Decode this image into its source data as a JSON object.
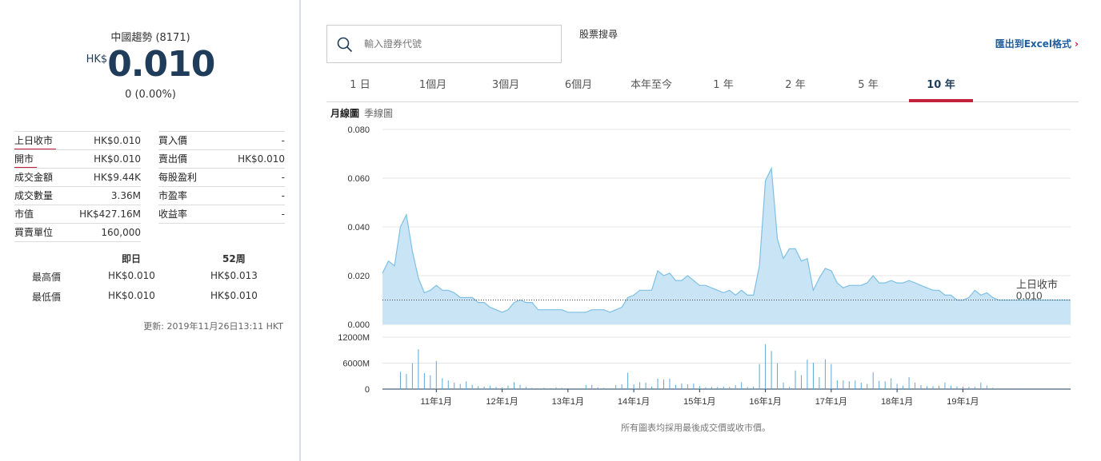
{
  "quote": {
    "name": "中國趨勢 (8171)",
    "currency": "HK$",
    "price": "0.010",
    "change": "0 (0.00%)"
  },
  "stats_left": [
    {
      "label": "上日收市",
      "value": "HK$0.010"
    },
    {
      "label": "開市",
      "value": "HK$0.010"
    },
    {
      "label": "成交金額",
      "value": "HK$9.44K"
    },
    {
      "label": "成交數量",
      "value": "3.36M"
    },
    {
      "label": "市值",
      "value": "HK$427.16M"
    },
    {
      "label": "買賣單位",
      "value": "160,000"
    }
  ],
  "stats_right": [
    {
      "label": "買入價",
      "value": "-"
    },
    {
      "label": "賣出價",
      "value": "HK$0.010"
    },
    {
      "label": "每股盈利",
      "value": "-"
    },
    {
      "label": "市盈率",
      "value": "-"
    },
    {
      "label": "收益率",
      "value": "-"
    }
  ],
  "range": {
    "headers": [
      "即日",
      "52周"
    ],
    "rows": [
      {
        "label": "最高價",
        "day": "HK$0.010",
        "week52": "HK$0.013"
      },
      {
        "label": "最低價",
        "day": "HK$0.010",
        "week52": "HK$0.010"
      }
    ]
  },
  "updated": "更新: 2019年11月26日13:11 HKT",
  "search": {
    "placeholder": "輸入證券代號",
    "title": "股票搜尋"
  },
  "export_label": "匯出到Excel格式",
  "tabs": [
    "1 日",
    "1個月",
    "3個月",
    "6個月",
    "本年至今",
    "1 年",
    "2 年",
    "5 年",
    "10 年"
  ],
  "active_tab": "10 年",
  "chart_types": [
    "月線圖",
    "季線圖"
  ],
  "footnote": "所有圖表均採用最後成交價或收市價。",
  "colors": {
    "accent": "#c4213f",
    "brand": "#1f3d5a",
    "area_fill": "#c9e4f5",
    "area_line": "#7ec0e4"
  },
  "chart_data": {
    "type": "area",
    "price": {
      "ylim": [
        0,
        0.08
      ],
      "yticks": [
        "0.080",
        "0.060",
        "0.040",
        "0.020",
        "0.000"
      ],
      "values": [
        0.021,
        0.026,
        0.024,
        0.04,
        0.045,
        0.03,
        0.019,
        0.013,
        0.014,
        0.016,
        0.014,
        0.014,
        0.013,
        0.011,
        0.011,
        0.011,
        0.009,
        0.009,
        0.007,
        0.006,
        0.005,
        0.006,
        0.009,
        0.01,
        0.009,
        0.009,
        0.006,
        0.006,
        0.006,
        0.006,
        0.006,
        0.005,
        0.005,
        0.005,
        0.005,
        0.006,
        0.006,
        0.006,
        0.005,
        0.006,
        0.007,
        0.011,
        0.012,
        0.014,
        0.014,
        0.014,
        0.022,
        0.02,
        0.021,
        0.018,
        0.018,
        0.02,
        0.018,
        0.016,
        0.016,
        0.015,
        0.014,
        0.013,
        0.014,
        0.012,
        0.014,
        0.012,
        0.012,
        0.024,
        0.059,
        0.064,
        0.035,
        0.027,
        0.031,
        0.031,
        0.026,
        0.027,
        0.014,
        0.019,
        0.023,
        0.022,
        0.017,
        0.015,
        0.016,
        0.016,
        0.016,
        0.017,
        0.02,
        0.017,
        0.017,
        0.018,
        0.017,
        0.017,
        0.018,
        0.017,
        0.016,
        0.015,
        0.014,
        0.014,
        0.012,
        0.012,
        0.01,
        0.01,
        0.011,
        0.014,
        0.012,
        0.013,
        0.011,
        0.01,
        0.01,
        0.01,
        0.01,
        0.01,
        0.01,
        0.01,
        0.01,
        0.01,
        0.01,
        0.01,
        0.01,
        0.01
      ],
      "reference_line": {
        "label": "上日收市",
        "value": 0.01,
        "value_label": "0.010"
      }
    },
    "volume": {
      "ylim": [
        0,
        12000
      ],
      "yticks": [
        "12000M",
        "6000M",
        "0"
      ],
      "values": [
        0,
        0,
        0,
        4000,
        3500,
        6000,
        9200,
        3700,
        3200,
        6500,
        2500,
        2000,
        1500,
        1200,
        1800,
        1000,
        700,
        600,
        800,
        500,
        400,
        800,
        1600,
        1000,
        500,
        300,
        200,
        300,
        200,
        400,
        300,
        200,
        200,
        200,
        900,
        1000,
        400,
        300,
        200,
        900,
        1100,
        3800,
        1100,
        1600,
        1500,
        600,
        2400,
        2200,
        2400,
        1000,
        1300,
        1100,
        1300,
        700,
        400,
        500,
        500,
        600,
        500,
        900,
        1600,
        500,
        600,
        5800,
        10400,
        8800,
        6000,
        1500,
        500,
        4300,
        3200,
        6800,
        6100,
        2800,
        6900,
        5800,
        2000,
        2000,
        1800,
        2000,
        1500,
        1200,
        3900,
        1900,
        1800,
        2500,
        1200,
        800,
        2800,
        1500,
        900,
        700,
        700,
        800,
        1500,
        800,
        600,
        600,
        500,
        500,
        1500,
        800,
        300,
        0,
        0,
        0,
        0,
        200,
        0,
        0,
        0,
        0,
        0,
        0,
        0,
        0
      ]
    },
    "x_labels": [
      "11年1月",
      "12年1月",
      "13年1月",
      "14年1月",
      "15年1月",
      "16年1月",
      "17年1月",
      "18年1月",
      "19年1月"
    ],
    "x_label_index": [
      9,
      20,
      31,
      42,
      53,
      64,
      75,
      86,
      97
    ],
    "grid": true
  }
}
